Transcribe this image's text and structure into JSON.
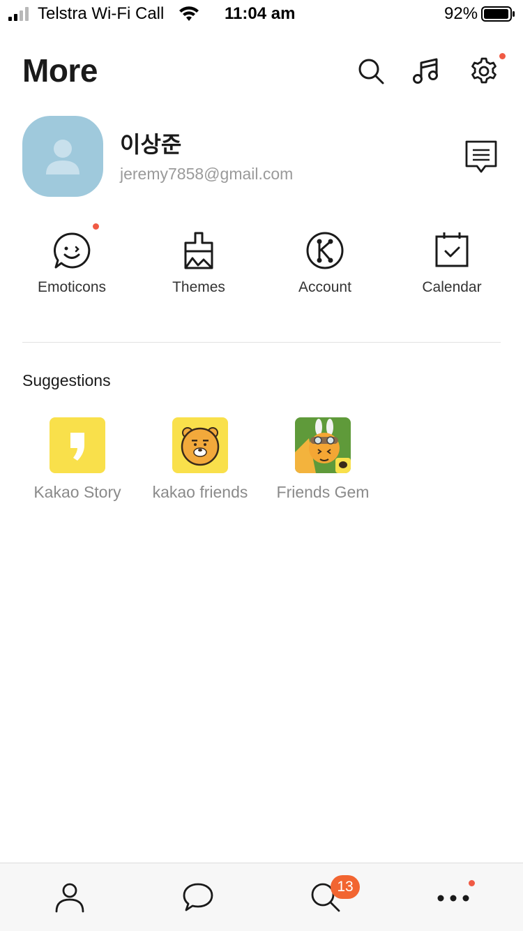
{
  "status_bar": {
    "carrier": "Telstra Wi-Fi Call",
    "time": "11:04 am",
    "battery": "92%"
  },
  "header": {
    "title": "More",
    "icons": [
      "search-icon",
      "music-icon",
      "settings-icon"
    ]
  },
  "profile": {
    "name": "이상준",
    "email": "jeremy7858@gmail.com"
  },
  "quick_menu": [
    {
      "label": "Emoticons",
      "icon": "emoticon-icon",
      "new_dot": true
    },
    {
      "label": "Themes",
      "icon": "brush-icon",
      "new_dot": false
    },
    {
      "label": "Account",
      "icon": "kakao-account-icon",
      "new_dot": false
    },
    {
      "label": "Calendar",
      "icon": "calendar-icon",
      "new_dot": false
    }
  ],
  "suggestions": {
    "title": "Suggestions",
    "items": [
      {
        "label": "Kakao Story",
        "icon": "kakao-story-icon"
      },
      {
        "label": "kakao friends",
        "icon": "kakao-friends-icon"
      },
      {
        "label": "Friends Gem",
        "icon": "friends-gem-icon"
      }
    ]
  },
  "tab_bar": {
    "tabs": [
      "friends-tab-icon",
      "chats-tab-icon",
      "discover-tab-icon",
      "more-tab-icon"
    ],
    "badge": "13"
  },
  "colors": {
    "accent_dot": "#f05a44",
    "badge": "#f26531",
    "avatar_bg": "#9fc9dc",
    "kakao_yellow": "#f9e04b"
  }
}
